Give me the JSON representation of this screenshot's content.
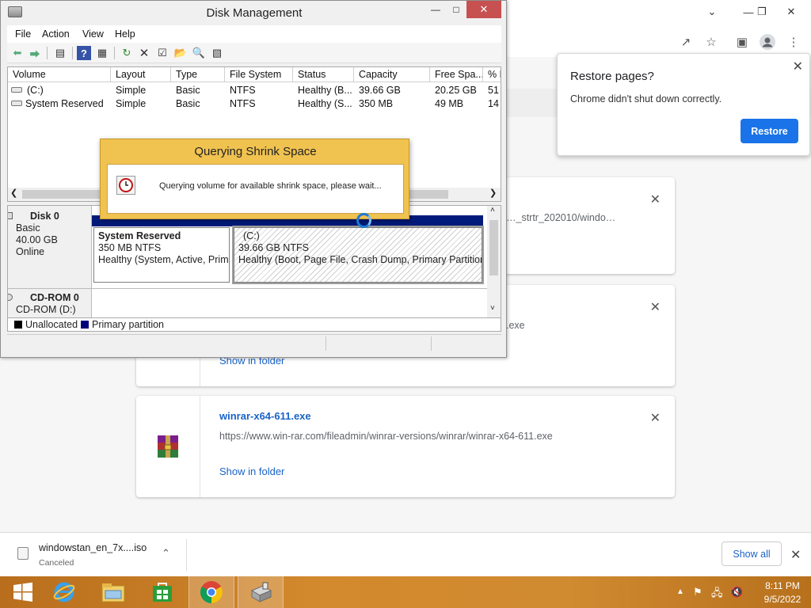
{
  "chrome": {
    "downloads": [
      {
        "name": "",
        "url": "…_strtr_202010/windo…",
        "show_in_folder": ""
      },
      {
        "name": "",
        "url": ".exe",
        "show_in_folder": "Show in folder"
      },
      {
        "name": "winrar-x64-611.exe",
        "url": "https://www.win-rar.com/fileadmin/winrar-versions/winrar/winrar-x64-611.exe",
        "show_in_folder": "Show in folder"
      }
    ],
    "restore_popup": {
      "title": "Restore pages?",
      "message": "Chrome didn't shut down correctly.",
      "button": "Restore"
    },
    "download_bar": {
      "item_name": "windowstan_en_7x....iso",
      "item_status": "Canceled",
      "show_all": "Show all"
    }
  },
  "disk_mgmt": {
    "title": "Disk Management",
    "menu": [
      "File",
      "Action",
      "View",
      "Help"
    ],
    "columns": [
      "Volume",
      "Layout",
      "Type",
      "File System",
      "Status",
      "Capacity",
      "Free Spa...",
      "% F"
    ],
    "volumes": [
      [
        "(C:)",
        "Simple",
        "Basic",
        "NTFS",
        "Healthy (B...",
        "39.66 GB",
        "20.25 GB",
        "51"
      ],
      [
        "System Reserved",
        "Simple",
        "Basic",
        "NTFS",
        "Healthy (S...",
        "350 MB",
        "49 MB",
        "14"
      ]
    ],
    "disk0": {
      "name": "Disk 0",
      "type": "Basic",
      "size": "40.00 GB",
      "status": "Online"
    },
    "partitions": [
      {
        "name": "System Reserved",
        "size": "350 MB NTFS",
        "status": "Healthy (System, Active, Primary Partition)"
      },
      {
        "name": "(C:)",
        "size": "39.66 GB NTFS",
        "status": "Healthy (Boot, Page File, Crash Dump, Primary Partition)"
      }
    ],
    "cdrom": {
      "name": "CD-ROM 0",
      "drive": "CD-ROM (D:)"
    },
    "legend": [
      "Unallocated",
      "Primary partition"
    ],
    "legend_colors": [
      "#000000",
      "#00007a"
    ]
  },
  "query_dialog": {
    "title": "Querying Shrink Space",
    "message": "Querying volume for available shrink space, please wait..."
  },
  "taskbar": {
    "apps": [
      "start-icon",
      "ie-icon",
      "explorer-icon",
      "store-icon",
      "chrome-icon",
      "disk-mgmt-icon"
    ],
    "time": "8:11 PM",
    "date": "9/5/2022"
  },
  "colors": {
    "chrome_blue": "#1a73e8",
    "dialog_gold": "#f0c250",
    "dm_close": "#c75050"
  }
}
